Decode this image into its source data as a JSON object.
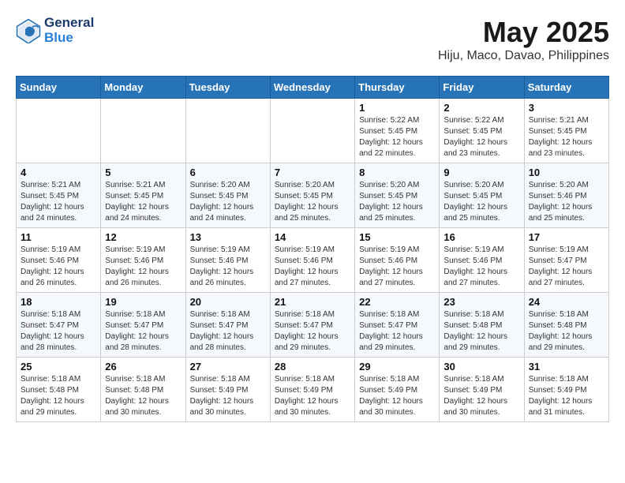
{
  "header": {
    "logo_line1": "General",
    "logo_line2": "Blue",
    "month": "May 2025",
    "location": "Hiju, Maco, Davao, Philippines"
  },
  "weekdays": [
    "Sunday",
    "Monday",
    "Tuesday",
    "Wednesday",
    "Thursday",
    "Friday",
    "Saturday"
  ],
  "weeks": [
    [
      {
        "day": "",
        "info": ""
      },
      {
        "day": "",
        "info": ""
      },
      {
        "day": "",
        "info": ""
      },
      {
        "day": "",
        "info": ""
      },
      {
        "day": "1",
        "info": "Sunrise: 5:22 AM\nSunset: 5:45 PM\nDaylight: 12 hours\nand 22 minutes."
      },
      {
        "day": "2",
        "info": "Sunrise: 5:22 AM\nSunset: 5:45 PM\nDaylight: 12 hours\nand 23 minutes."
      },
      {
        "day": "3",
        "info": "Sunrise: 5:21 AM\nSunset: 5:45 PM\nDaylight: 12 hours\nand 23 minutes."
      }
    ],
    [
      {
        "day": "4",
        "info": "Sunrise: 5:21 AM\nSunset: 5:45 PM\nDaylight: 12 hours\nand 24 minutes."
      },
      {
        "day": "5",
        "info": "Sunrise: 5:21 AM\nSunset: 5:45 PM\nDaylight: 12 hours\nand 24 minutes."
      },
      {
        "day": "6",
        "info": "Sunrise: 5:20 AM\nSunset: 5:45 PM\nDaylight: 12 hours\nand 24 minutes."
      },
      {
        "day": "7",
        "info": "Sunrise: 5:20 AM\nSunset: 5:45 PM\nDaylight: 12 hours\nand 25 minutes."
      },
      {
        "day": "8",
        "info": "Sunrise: 5:20 AM\nSunset: 5:45 PM\nDaylight: 12 hours\nand 25 minutes."
      },
      {
        "day": "9",
        "info": "Sunrise: 5:20 AM\nSunset: 5:45 PM\nDaylight: 12 hours\nand 25 minutes."
      },
      {
        "day": "10",
        "info": "Sunrise: 5:20 AM\nSunset: 5:46 PM\nDaylight: 12 hours\nand 25 minutes."
      }
    ],
    [
      {
        "day": "11",
        "info": "Sunrise: 5:19 AM\nSunset: 5:46 PM\nDaylight: 12 hours\nand 26 minutes."
      },
      {
        "day": "12",
        "info": "Sunrise: 5:19 AM\nSunset: 5:46 PM\nDaylight: 12 hours\nand 26 minutes."
      },
      {
        "day": "13",
        "info": "Sunrise: 5:19 AM\nSunset: 5:46 PM\nDaylight: 12 hours\nand 26 minutes."
      },
      {
        "day": "14",
        "info": "Sunrise: 5:19 AM\nSunset: 5:46 PM\nDaylight: 12 hours\nand 27 minutes."
      },
      {
        "day": "15",
        "info": "Sunrise: 5:19 AM\nSunset: 5:46 PM\nDaylight: 12 hours\nand 27 minutes."
      },
      {
        "day": "16",
        "info": "Sunrise: 5:19 AM\nSunset: 5:46 PM\nDaylight: 12 hours\nand 27 minutes."
      },
      {
        "day": "17",
        "info": "Sunrise: 5:19 AM\nSunset: 5:47 PM\nDaylight: 12 hours\nand 27 minutes."
      }
    ],
    [
      {
        "day": "18",
        "info": "Sunrise: 5:18 AM\nSunset: 5:47 PM\nDaylight: 12 hours\nand 28 minutes."
      },
      {
        "day": "19",
        "info": "Sunrise: 5:18 AM\nSunset: 5:47 PM\nDaylight: 12 hours\nand 28 minutes."
      },
      {
        "day": "20",
        "info": "Sunrise: 5:18 AM\nSunset: 5:47 PM\nDaylight: 12 hours\nand 28 minutes."
      },
      {
        "day": "21",
        "info": "Sunrise: 5:18 AM\nSunset: 5:47 PM\nDaylight: 12 hours\nand 29 minutes."
      },
      {
        "day": "22",
        "info": "Sunrise: 5:18 AM\nSunset: 5:47 PM\nDaylight: 12 hours\nand 29 minutes."
      },
      {
        "day": "23",
        "info": "Sunrise: 5:18 AM\nSunset: 5:48 PM\nDaylight: 12 hours\nand 29 minutes."
      },
      {
        "day": "24",
        "info": "Sunrise: 5:18 AM\nSunset: 5:48 PM\nDaylight: 12 hours\nand 29 minutes."
      }
    ],
    [
      {
        "day": "25",
        "info": "Sunrise: 5:18 AM\nSunset: 5:48 PM\nDaylight: 12 hours\nand 29 minutes."
      },
      {
        "day": "26",
        "info": "Sunrise: 5:18 AM\nSunset: 5:48 PM\nDaylight: 12 hours\nand 30 minutes."
      },
      {
        "day": "27",
        "info": "Sunrise: 5:18 AM\nSunset: 5:49 PM\nDaylight: 12 hours\nand 30 minutes."
      },
      {
        "day": "28",
        "info": "Sunrise: 5:18 AM\nSunset: 5:49 PM\nDaylight: 12 hours\nand 30 minutes."
      },
      {
        "day": "29",
        "info": "Sunrise: 5:18 AM\nSunset: 5:49 PM\nDaylight: 12 hours\nand 30 minutes."
      },
      {
        "day": "30",
        "info": "Sunrise: 5:18 AM\nSunset: 5:49 PM\nDaylight: 12 hours\nand 30 minutes."
      },
      {
        "day": "31",
        "info": "Sunrise: 5:18 AM\nSunset: 5:49 PM\nDaylight: 12 hours\nand 31 minutes."
      }
    ]
  ]
}
